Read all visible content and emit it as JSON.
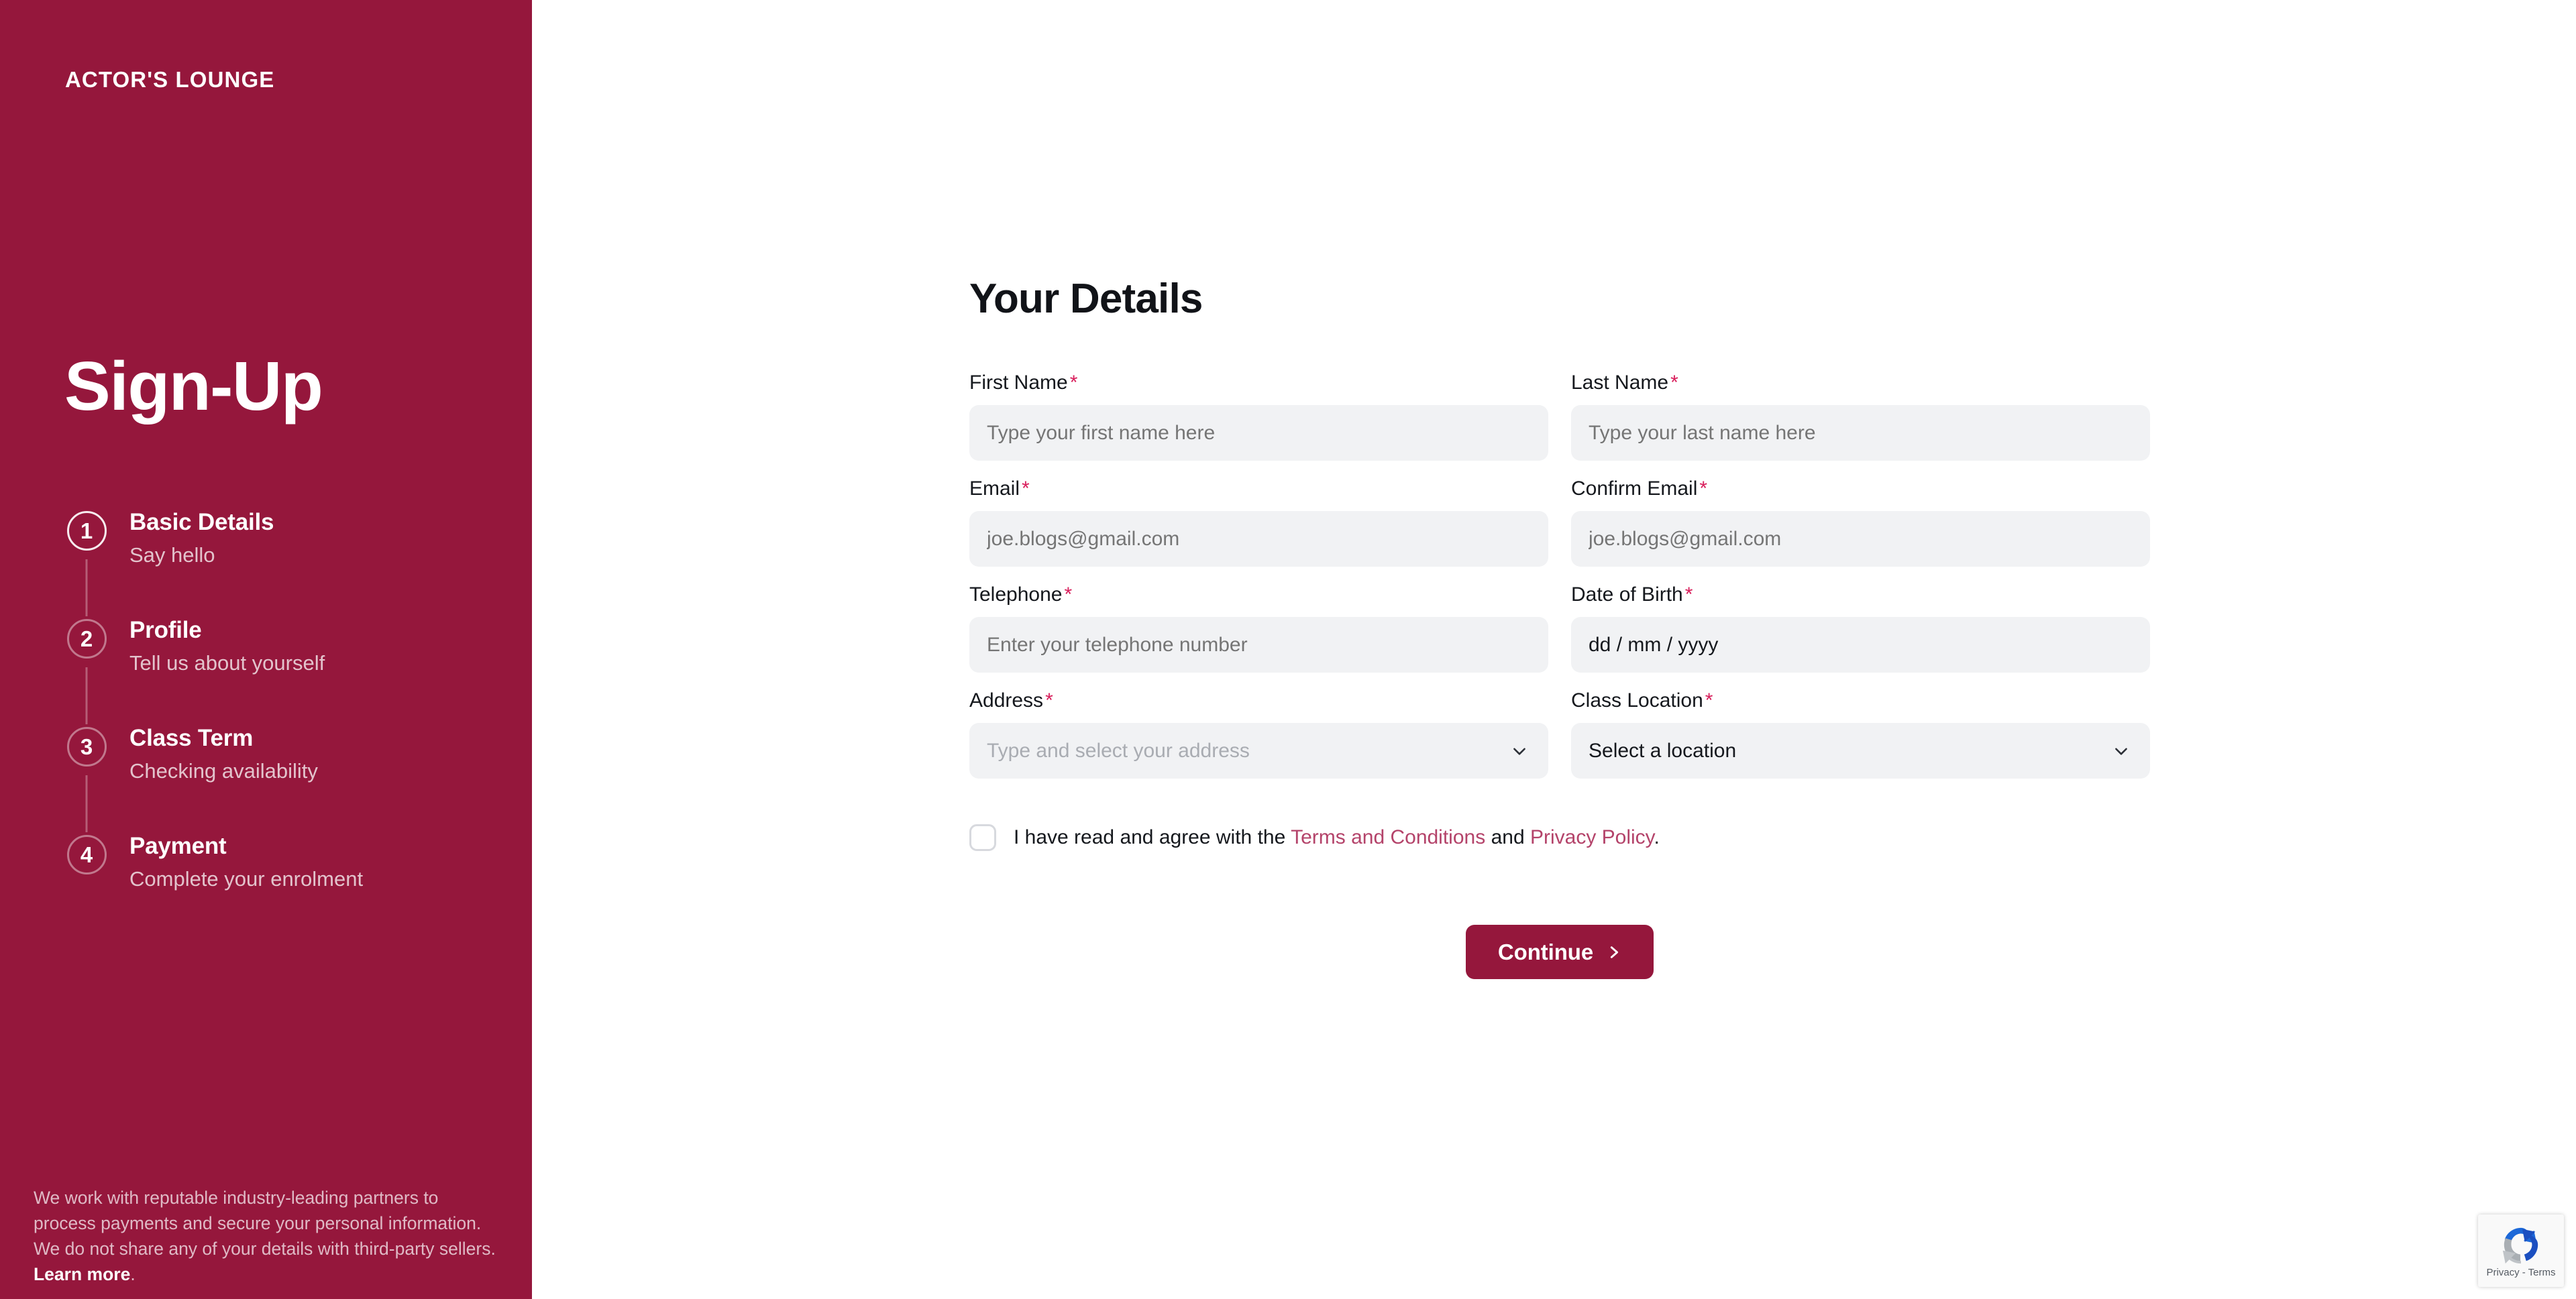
{
  "colors": {
    "brand_maroon": "#95173c",
    "required_asterisk": "#d81e5b",
    "link_pink": "#b4436a",
    "input_bg": "#f1f2f4",
    "text_dark": "#15181d",
    "placeholder": "#a9acb2"
  },
  "sidebar": {
    "brand": "ACTOR'S LOUNGE",
    "title": "Sign-Up",
    "steps": [
      {
        "number": "1",
        "title": "Basic Details",
        "subtitle": "Say hello",
        "active": true
      },
      {
        "number": "2",
        "title": "Profile",
        "subtitle": "Tell us about yourself",
        "active": false
      },
      {
        "number": "3",
        "title": "Class Term",
        "subtitle": "Checking availability",
        "active": false
      },
      {
        "number": "4",
        "title": "Payment",
        "subtitle": "Complete your enrolment",
        "active": false
      }
    ],
    "footer": {
      "text": "We work with reputable industry-leading partners to process payments and secure your personal information. We do not share any of your details with third-party sellers. ",
      "link_label": "Learn more",
      "trailing": "."
    }
  },
  "form": {
    "heading": "Your Details",
    "fields": {
      "first_name": {
        "label": "First Name",
        "required_mark": "*",
        "placeholder": "Type your first name here",
        "value": ""
      },
      "last_name": {
        "label": "Last Name",
        "required_mark": "*",
        "placeholder": "Type your last name here",
        "value": ""
      },
      "email": {
        "label": "Email",
        "required_mark": "*",
        "placeholder": "joe.blogs@gmail.com",
        "value": ""
      },
      "confirm_email": {
        "label": "Confirm Email",
        "required_mark": "*",
        "placeholder": "joe.blogs@gmail.com",
        "value": ""
      },
      "telephone": {
        "label": "Telephone",
        "required_mark": "*",
        "placeholder": "Enter your telephone number",
        "value": ""
      },
      "date_of_birth": {
        "label": "Date of Birth",
        "required_mark": "*",
        "placeholder": "dd/mm/yyyy",
        "value": "dd / mm / yyyy"
      },
      "address": {
        "label": "Address",
        "required_mark": "*",
        "placeholder": "Type and select your address",
        "value": "",
        "icon": "chevron-down-icon"
      },
      "class_location": {
        "label": "Class Location",
        "required_mark": "*",
        "placeholder": "Select a location",
        "value": "Select a location",
        "icon": "chevron-down-icon"
      }
    },
    "terms": {
      "checked": false,
      "lead": "I have read and agree with the ",
      "terms_link": "Terms and Conditions",
      "conjunction": " and ",
      "privacy_link": "Privacy Policy",
      "trailing": "."
    },
    "submit": {
      "label": "Continue",
      "icon": "chevron-right-icon"
    }
  },
  "recaptcha": {
    "icon": "recaptcha-logo-icon",
    "text": "Privacy - Terms"
  }
}
